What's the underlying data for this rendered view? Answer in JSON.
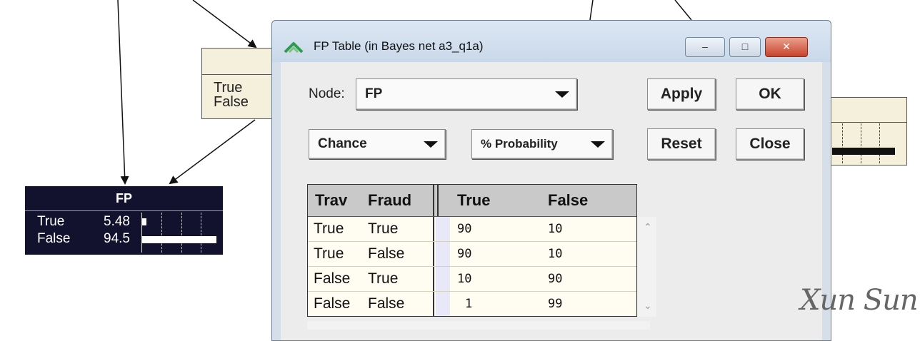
{
  "canvas": {
    "top_node": {
      "states": [
        "True",
        "False"
      ]
    },
    "fp_node": {
      "title": "FP",
      "rows": [
        {
          "label": "True",
          "value": "5.48",
          "level": 0.0548
        },
        {
          "label": "False",
          "value": "94.5",
          "level": 0.945
        }
      ]
    }
  },
  "dialog": {
    "title": "FP Table (in Bayes net a3_q1a)",
    "window_buttons": {
      "minimize": "–",
      "maximize": "□",
      "close": "✕"
    },
    "node_label": "Node:",
    "node_value": "FP",
    "type_value": "Chance",
    "format_value": "% Probability",
    "buttons": {
      "apply": "Apply",
      "ok": "OK",
      "reset": "Reset",
      "close": "Close"
    },
    "table": {
      "headers": [
        "Trav",
        "Fraud",
        "True",
        "False"
      ],
      "rows": [
        [
          "True",
          "True",
          "90",
          "10"
        ],
        [
          "True",
          "False",
          "90",
          "10"
        ],
        [
          "False",
          "True",
          "10",
          "90"
        ],
        [
          "False",
          "False",
          "1",
          "99"
        ]
      ]
    }
  },
  "watermark": "Xun Sun",
  "colors": {
    "node_bg": "#f5f0dc",
    "fp_node_bg": "#12122e",
    "dialog_frame": "#d6dfe9",
    "table_header": "#c9c9c9",
    "table_body": "#fffdf2",
    "close_button": "#c7432a"
  }
}
